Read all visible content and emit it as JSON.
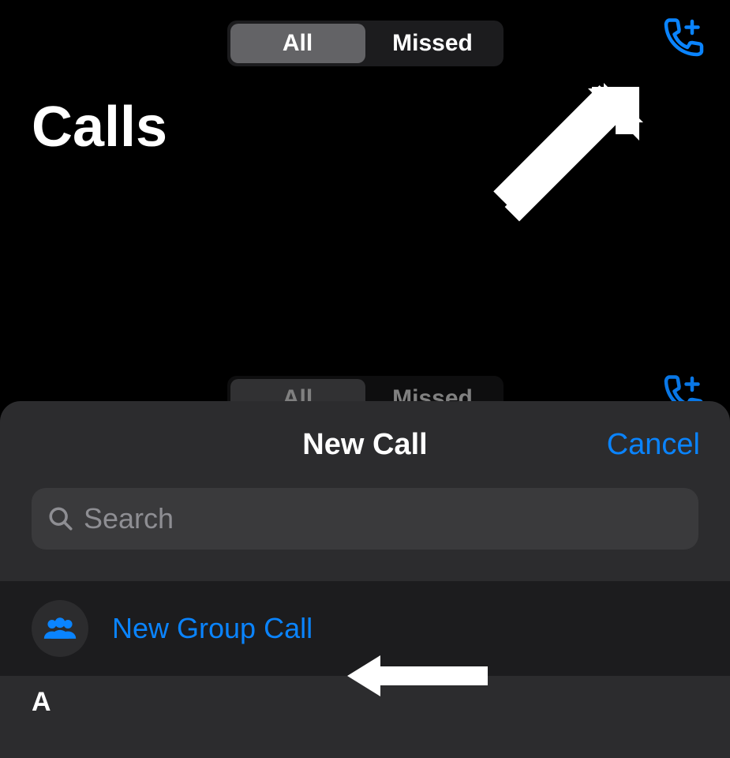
{
  "header": {
    "seg_all": "All",
    "seg_missed": "Missed",
    "title": "Calls",
    "new_call_icon": "phone-plus-icon"
  },
  "ghost": {
    "seg_all": "All",
    "seg_missed": "Missed"
  },
  "sheet": {
    "title": "New Call",
    "cancel": "Cancel",
    "search_placeholder": "Search",
    "search_value": "",
    "group_call_label": "New Group Call",
    "section_letter": "A"
  },
  "colors": {
    "accent": "#0a84ff",
    "bg": "#000000",
    "sheet_bg": "#2c2c2e",
    "input_bg": "#3a3a3c",
    "row_bg": "#1c1c1e",
    "placeholder": "#8e8e93"
  }
}
